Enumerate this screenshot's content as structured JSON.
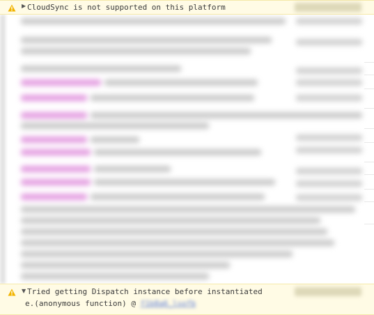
{
  "warnings": [
    {
      "icon": "warning-icon",
      "expanded": false,
      "toggle_glyph": "▶",
      "message": "CloudSync is not supported on this platform"
    },
    {
      "icon": "warning-icon",
      "expanded": true,
      "toggle_glyph": "▼",
      "message": "Tried getting Dispatch instance before instantiated",
      "stack_function": "e.(anonymous function) @",
      "stack_link": "f1b8a6_lsofb"
    }
  ],
  "colors": {
    "warning_background": "#fffbe5",
    "warning_icon": "#f2b400",
    "highlight": "#e39be0"
  }
}
